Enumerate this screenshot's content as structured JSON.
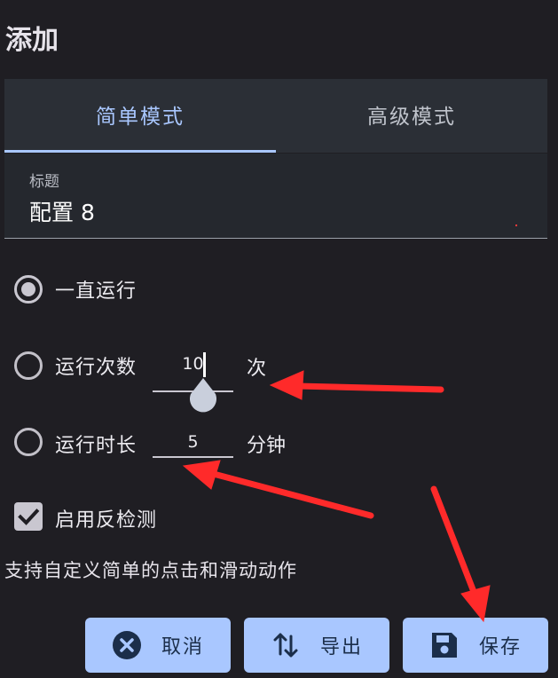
{
  "dialog": {
    "title": "添加"
  },
  "tabs": [
    {
      "label": "简单模式",
      "active": true
    },
    {
      "label": "高级模式",
      "active": false
    }
  ],
  "title_field": {
    "label": "标题",
    "value": "配置 8"
  },
  "options": {
    "run_forever": {
      "label": "一直运行",
      "selected": true
    },
    "run_count": {
      "label": "运行次数",
      "value": "10",
      "unit": "次",
      "selected": false
    },
    "run_duration": {
      "label": "运行时长",
      "value": "5",
      "unit": "分钟",
      "selected": false
    }
  },
  "anti_detect": {
    "label": "启用反检测",
    "checked": true
  },
  "description": "支持自定义简单的点击和滑动动作",
  "buttons": {
    "cancel": "取消",
    "export": "导出",
    "save": "保存"
  },
  "colors": {
    "accent": "#a9c7ff",
    "background": "#1f1e23",
    "annotation_arrow": "#ff2a2a"
  },
  "icons": [
    "cancel-circle-icon",
    "swap-vertical-icon",
    "save-floppy-icon",
    "check-icon"
  ]
}
